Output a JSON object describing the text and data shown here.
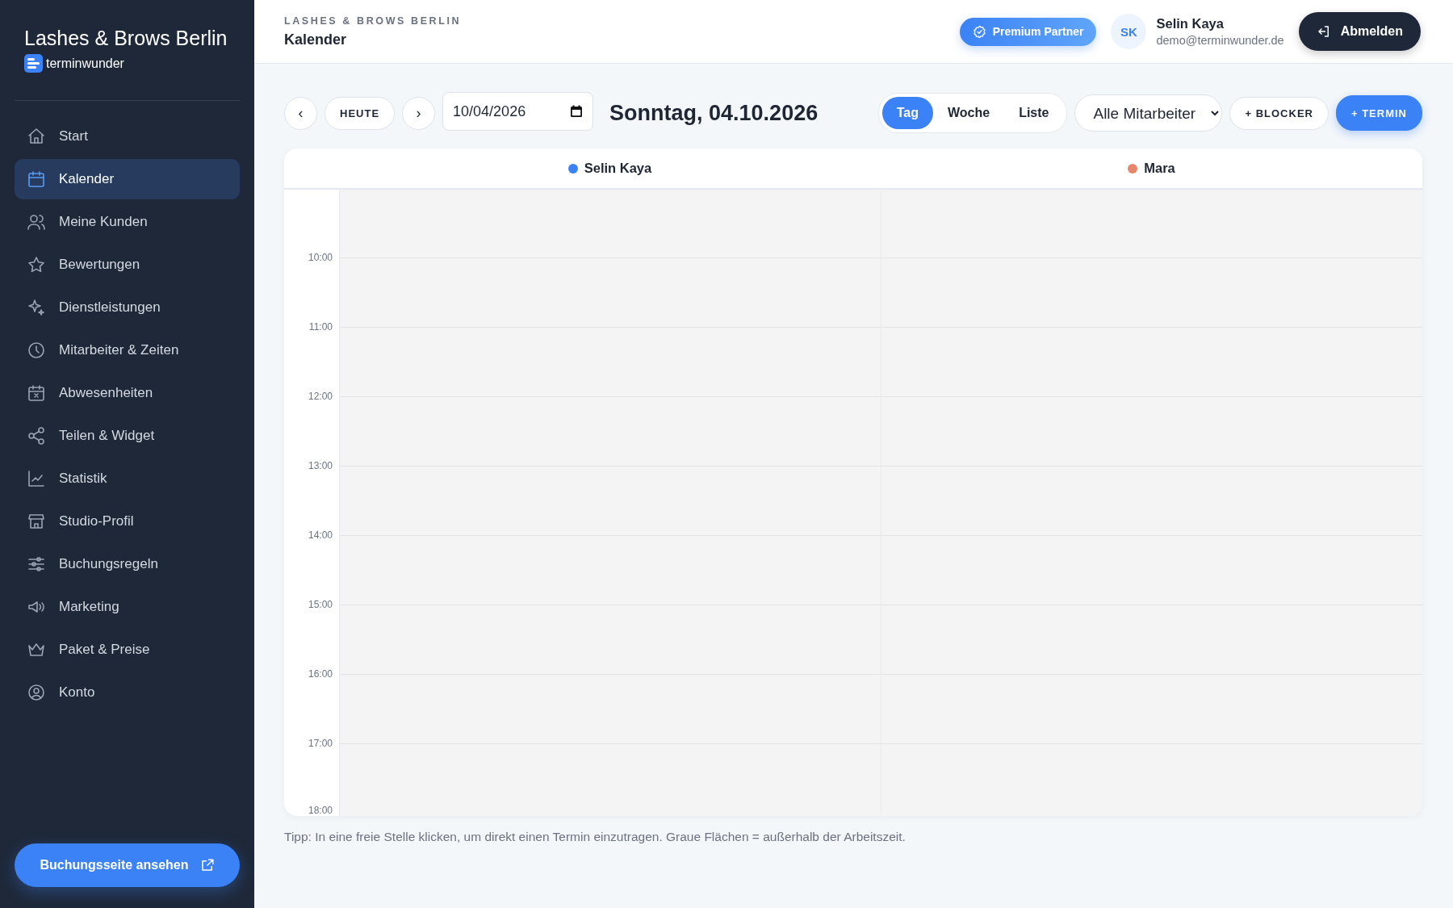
{
  "sidebar": {
    "studio_name": "Lashes & Brows Berlin",
    "brand": "terminwunder",
    "items": [
      {
        "label": "Start",
        "selected": false
      },
      {
        "label": "Kalender",
        "selected": true
      },
      {
        "label": "Meine Kunden",
        "selected": false
      },
      {
        "label": "Bewertungen",
        "selected": false
      },
      {
        "label": "Dienstleistungen",
        "selected": false
      },
      {
        "label": "Mitarbeiter & Zeiten",
        "selected": false
      },
      {
        "label": "Abwesenheiten",
        "selected": false
      },
      {
        "label": "Teilen & Widget",
        "selected": false
      },
      {
        "label": "Statistik",
        "selected": false
      },
      {
        "label": "Studio-Profil",
        "selected": false
      },
      {
        "label": "Buchungsregeln",
        "selected": false
      },
      {
        "label": "Marketing",
        "selected": false
      },
      {
        "label": "Paket & Preise",
        "selected": false
      },
      {
        "label": "Konto",
        "selected": false
      }
    ],
    "booking_button": "Buchungsseite ansehen"
  },
  "header": {
    "eyebrow": "LASHES & BROWS BERLIN",
    "title": "Kalender",
    "badge": "Premium Partner",
    "avatar": "SK",
    "user_name": "Selin Kaya",
    "user_email": "demo@terminwunder.de",
    "logout": "Abmelden"
  },
  "toolbar": {
    "prev": "‹",
    "today": "HEUTE",
    "next": "›",
    "date_value": "10/04/2026",
    "date_heading": "Sonntag, 04.10.2026",
    "views": [
      {
        "label": "Tag",
        "selected": true
      },
      {
        "label": "Woche",
        "selected": false
      },
      {
        "label": "Liste",
        "selected": false
      }
    ],
    "staff_filter": "Alle Mitarbeiter",
    "blocker": "+ BLOCKER",
    "new_appointment": "+ TERMIN"
  },
  "calendar": {
    "staff": [
      {
        "name": "Selin Kaya",
        "color": "#3b82f6"
      },
      {
        "name": "Mara",
        "color": "#e8866a"
      }
    ],
    "hours": [
      "10:00",
      "11:00",
      "12:00",
      "13:00",
      "14:00",
      "15:00",
      "16:00",
      "17:00"
    ],
    "end_hour": "18:00"
  },
  "tip": "Tipp: In eine freie Stelle klicken, um direkt einen Termin einzutragen. Graue Flächen = außerhalb der Arbeitszeit."
}
